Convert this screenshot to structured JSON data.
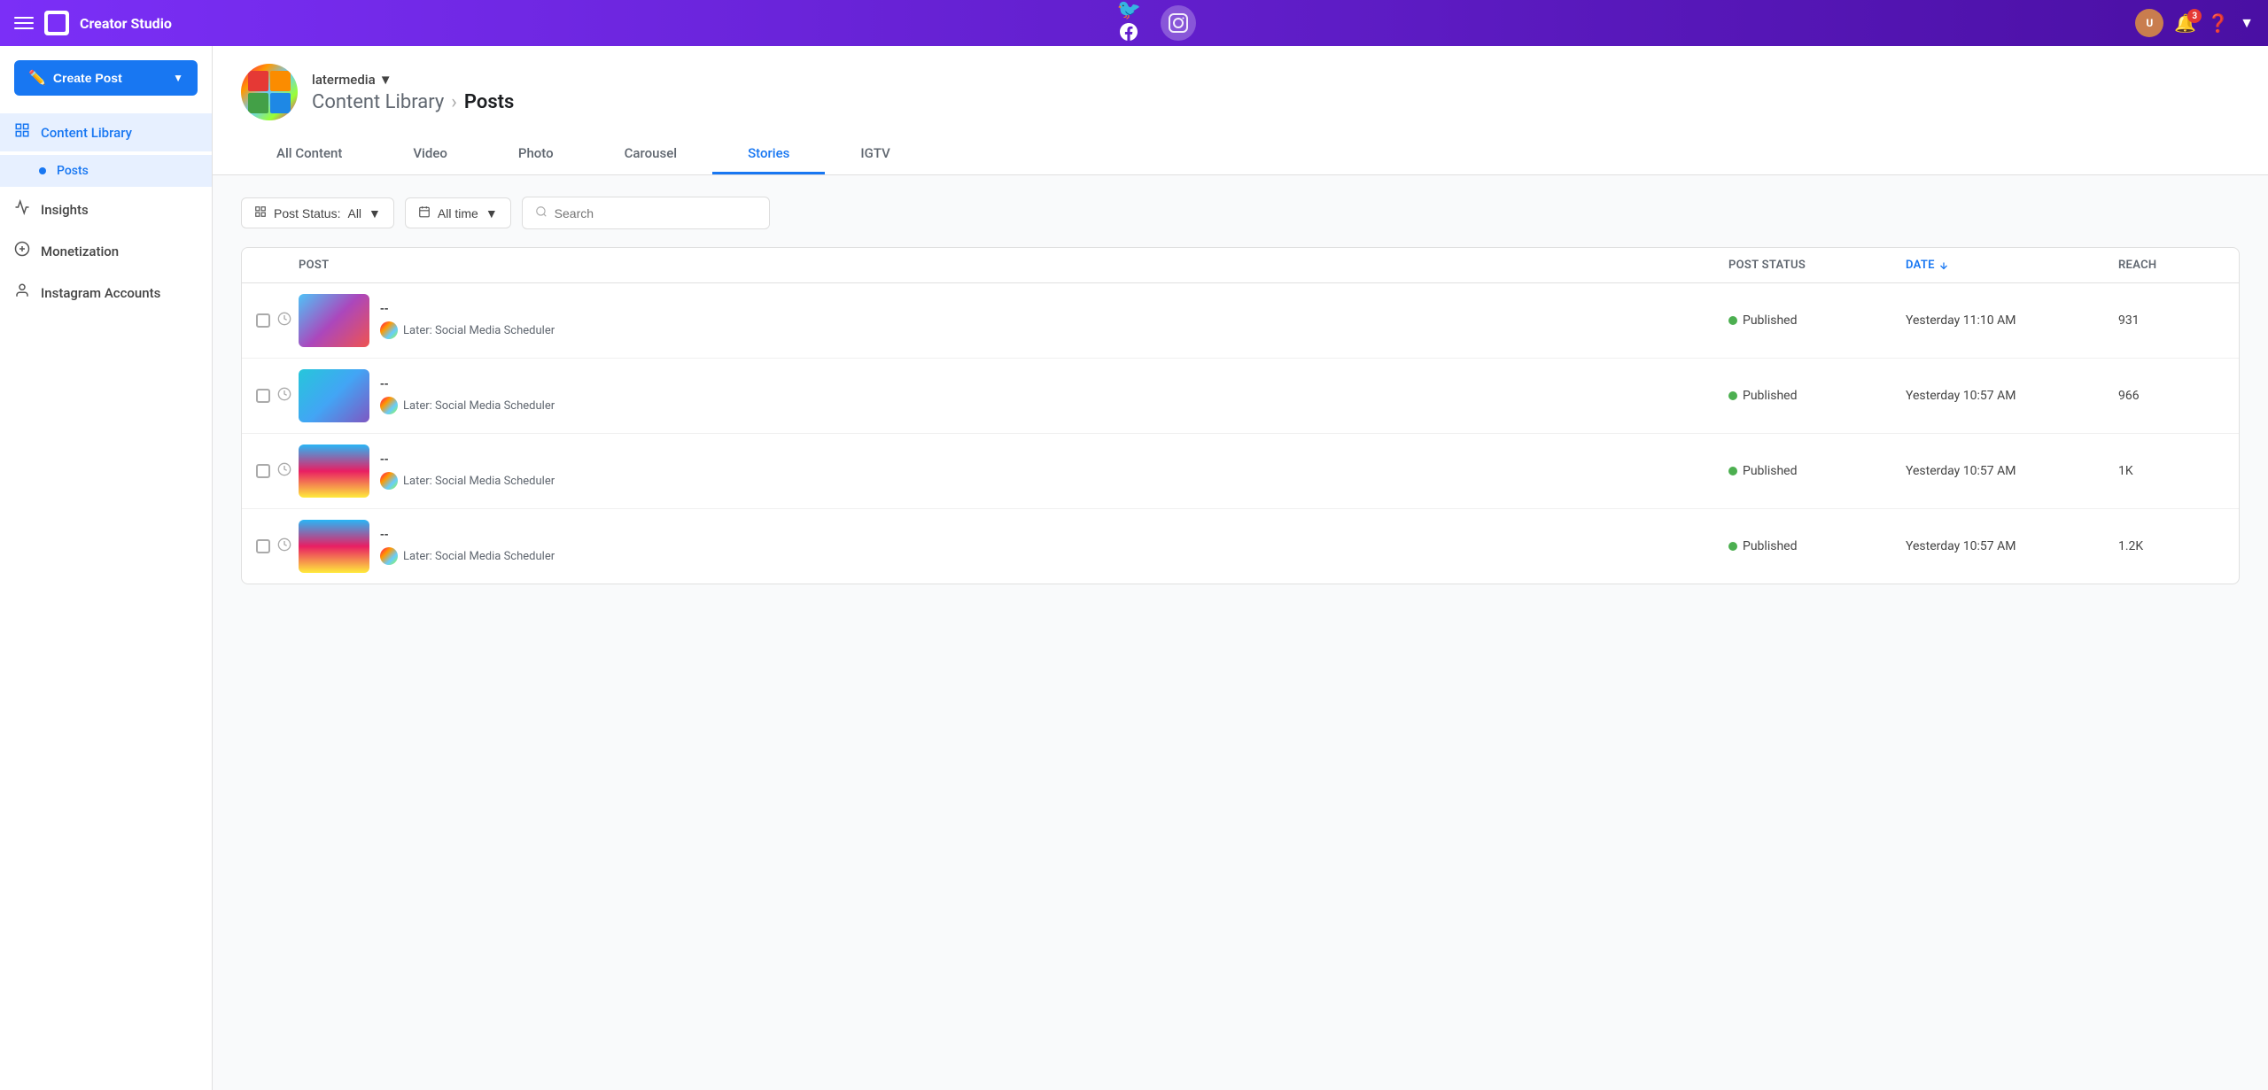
{
  "topnav": {
    "hamburger_label": "menu",
    "logo_label": "Creator Studio",
    "title": "Creator Studio",
    "platforms": [
      {
        "id": "facebook",
        "label": "Facebook",
        "active": false
      },
      {
        "id": "instagram",
        "label": "Instagram",
        "active": true
      }
    ],
    "notifications_count": "3",
    "help_label": "Help",
    "chevron_label": "expand"
  },
  "sidebar": {
    "create_post_label": "Create Post",
    "items": [
      {
        "id": "content-library",
        "label": "Content Library",
        "icon": "📋",
        "active": true,
        "has_sub": true
      },
      {
        "id": "posts",
        "label": "Posts",
        "active": true,
        "sub": true
      },
      {
        "id": "insights",
        "label": "Insights",
        "icon": "📈",
        "active": false
      },
      {
        "id": "monetization",
        "label": "Monetization",
        "icon": "💲",
        "active": false
      },
      {
        "id": "instagram-accounts",
        "label": "Instagram Accounts",
        "icon": "👤",
        "active": false
      }
    ]
  },
  "header": {
    "account_name": "latermedia",
    "breadcrumb_parent": "Content Library",
    "breadcrumb_current": "Posts",
    "tabs": [
      {
        "id": "all-content",
        "label": "All Content",
        "active": false
      },
      {
        "id": "video",
        "label": "Video",
        "active": false
      },
      {
        "id": "photo",
        "label": "Photo",
        "active": false
      },
      {
        "id": "carousel",
        "label": "Carousel",
        "active": false
      },
      {
        "id": "stories",
        "label": "Stories",
        "active": true
      },
      {
        "id": "igtv",
        "label": "IGTV",
        "active": false
      }
    ]
  },
  "filters": {
    "post_status_label": "Post Status:",
    "post_status_value": "All",
    "all_time_label": "All time",
    "search_placeholder": "Search"
  },
  "table": {
    "columns": [
      {
        "id": "select",
        "label": ""
      },
      {
        "id": "post",
        "label": "Post"
      },
      {
        "id": "post-status",
        "label": "Post Status"
      },
      {
        "id": "date",
        "label": "Date",
        "sortable": true,
        "sort_dir": "desc"
      },
      {
        "id": "reach",
        "label": "Reach"
      }
    ],
    "rows": [
      {
        "id": "row-1",
        "title": "--",
        "source": "Later: Social Media Scheduler",
        "status": "Published",
        "date": "Yesterday 11:10 AM",
        "reach": "931",
        "thumb_class": "thumb-1"
      },
      {
        "id": "row-2",
        "title": "--",
        "source": "Later: Social Media Scheduler",
        "status": "Published",
        "date": "Yesterday 10:57 AM",
        "reach": "966",
        "thumb_class": "thumb-2"
      },
      {
        "id": "row-3",
        "title": "--",
        "source": "Later: Social Media Scheduler",
        "status": "Published",
        "date": "Yesterday 10:57 AM",
        "reach": "1K",
        "thumb_class": "thumb-3"
      },
      {
        "id": "row-4",
        "title": "--",
        "source": "Later: Social Media Scheduler",
        "status": "Published",
        "date": "Yesterday 10:57 AM",
        "reach": "1.2K",
        "thumb_class": "thumb-4"
      }
    ]
  }
}
